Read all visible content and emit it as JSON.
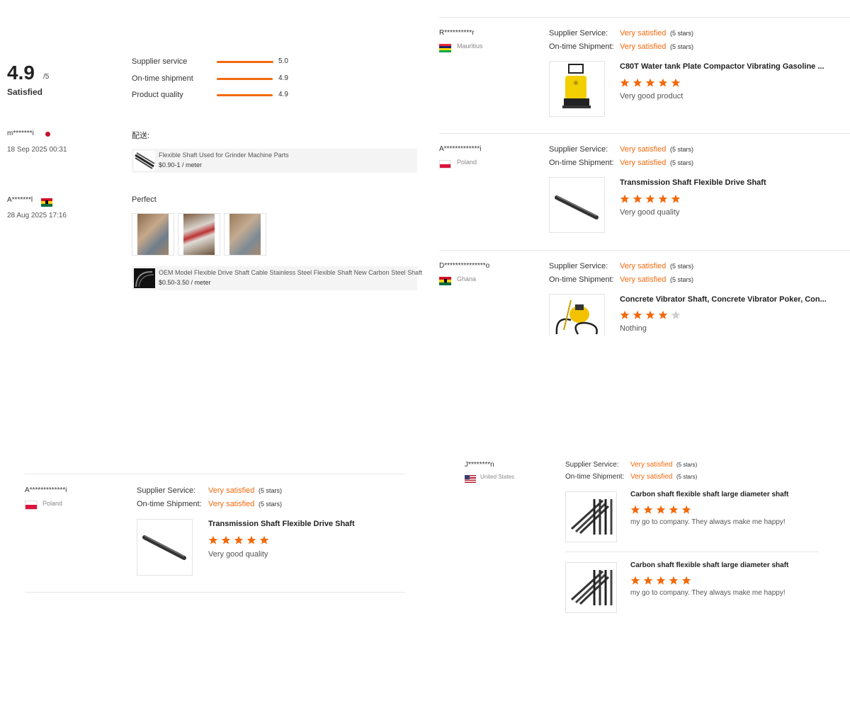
{
  "summary": {
    "score": "4.9",
    "out_of": "/5",
    "verdict": "Satisfied",
    "rows": [
      {
        "label": "Supplier service",
        "value": "5.0",
        "fill": 1.0
      },
      {
        "label": "On-time shipment",
        "value": "4.9",
        "fill": 0.98
      },
      {
        "label": "Product quality",
        "value": "4.9",
        "fill": 0.98
      }
    ]
  },
  "left_reviews": [
    {
      "user": "m*******i",
      "date": "18 Sep 2025 00:31",
      "comment": "配送:",
      "product": {
        "title": "Flexible Shaft Used for Grinder Machine Parts",
        "price": "$0.90-1 / meter"
      }
    },
    {
      "user": "A*******l",
      "date": "28 Aug 2025 17:16",
      "comment": "Perfect",
      "product": {
        "title": "OEM Model Flexible Drive Shaft Cable Stainless Steel Flexible Shaft New Carbon Steel Shaft",
        "price": "$0.50-3.50 / meter"
      }
    }
  ],
  "labels": {
    "supplier_service": "Supplier Service:",
    "ontime_shipment": "On-time Shipment:",
    "very_satisfied": "Very satisfied",
    "five_stars": "(5 stars)"
  },
  "right_reviews": [
    {
      "user": "R**********r",
      "country": "Mauritius",
      "product": "C80T Water tank Plate Compactor Vibrating Gasoline ...",
      "rating": 5,
      "text": "Very good product"
    },
    {
      "user": "A*************i",
      "country": "Poland",
      "product": "Transmission Shaft Flexible Drive Shaft",
      "rating": 5,
      "text": "Very good quality"
    },
    {
      "user": "D***************o",
      "country": "Ghana",
      "product": "Concrete Vibrator Shaft, Concrete Vibrator Poker, Con...",
      "rating": 4,
      "text": "Nothing"
    }
  ],
  "bottom_left_review": {
    "user": "A*************i",
    "country": "Poland",
    "product": "Transmission Shaft Flexible Drive Shaft",
    "rating": 5,
    "text": "Very good quality"
  },
  "bottom_right_review": {
    "user": "J********n",
    "country": "United States",
    "items": [
      {
        "product": "Carbon shaft flexible shaft large diameter shaft",
        "rating": 5,
        "text": "my go to company. They always make me happy!"
      },
      {
        "product": "Carbon shaft flexible shaft large diameter shaft",
        "rating": 5,
        "text": "my go to company. They always make me happy!"
      }
    ]
  },
  "colors": {
    "accent": "#f26a0e",
    "star_empty": "#cfcfcf"
  }
}
